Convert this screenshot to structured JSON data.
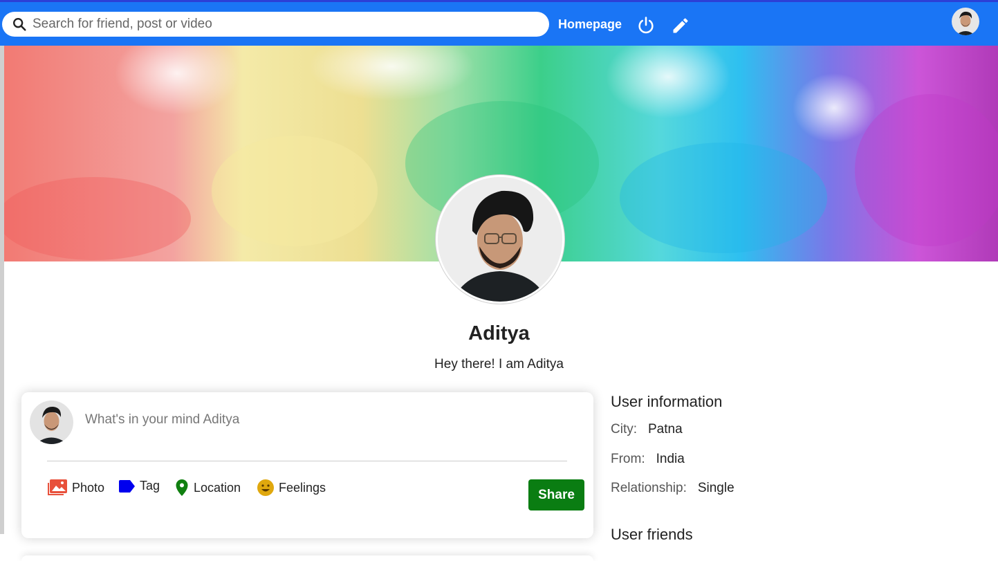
{
  "topbar": {
    "search_placeholder": "Search for friend, post or video",
    "homepage_label": "Homepage",
    "power_icon": "power-icon",
    "edit_icon": "pencil-icon"
  },
  "profile": {
    "name": "Aditya",
    "description": "Hey there! I am Aditya"
  },
  "share": {
    "placeholder": "What's in your mind Aditya",
    "options": [
      {
        "label": "Photo",
        "icon": "photo-icon",
        "color": "#e8503a"
      },
      {
        "label": "Tag",
        "icon": "tag-icon",
        "color": "#0000ee"
      },
      {
        "label": "Location",
        "icon": "location-icon",
        "color": "#108010"
      },
      {
        "label": "Feelings",
        "icon": "emoji-icon",
        "color": "#e0a80e"
      }
    ],
    "button_label": "Share",
    "button_color": "#0a7d12"
  },
  "user_info": {
    "title": "User information",
    "rows": [
      {
        "key": "City:",
        "value": "Patna"
      },
      {
        "key": "From:",
        "value": "India"
      },
      {
        "key": "Relationship:",
        "value": "Single"
      }
    ],
    "friends_title": "User friends"
  },
  "colors": {
    "topbar": "#1a75f5",
    "topbar_border": "#2c3fd6"
  }
}
